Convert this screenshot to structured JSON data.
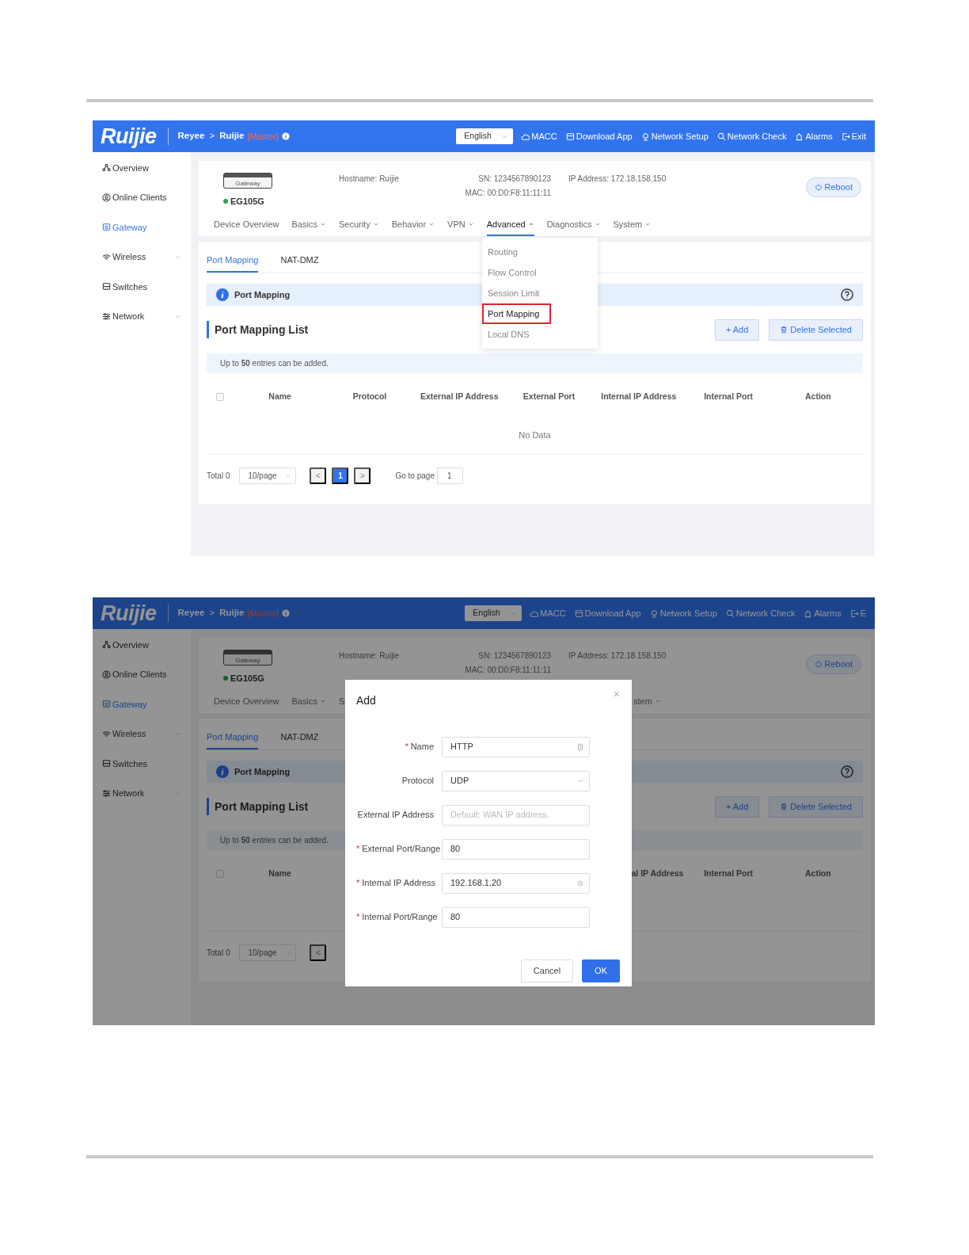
{
  "screens": [
    {
      "header": {
        "logo": "Ruijie",
        "crumbs": [
          "Reyee",
          "Ruijie"
        ],
        "separator": ">",
        "role": "[Master]",
        "language": "English",
        "links": [
          "MACC",
          "Download App",
          "Network Setup",
          "Network Check",
          "Alarms",
          "Exit"
        ]
      },
      "sidebar": [
        {
          "label": "Overview",
          "selected": false,
          "expandable": false
        },
        {
          "label": "Online Clients",
          "selected": false,
          "expandable": false
        },
        {
          "label": "Gateway",
          "selected": true,
          "expandable": false
        },
        {
          "label": "Wireless",
          "selected": false,
          "expandable": true
        },
        {
          "label": "Switches",
          "selected": false,
          "expandable": false
        },
        {
          "label": "Network",
          "selected": false,
          "expandable": true
        }
      ],
      "device": {
        "device_label": "Gateway",
        "model": "EG105G",
        "online": true,
        "hostname": "Hostname: Ruijie",
        "sn": "SN: 1234567890123",
        "mac": "MAC: 00:D0:F8:11:11:11",
        "ip": "IP Address: 172.18.158.150",
        "reboot": "Reboot"
      },
      "nav_tabs": [
        {
          "label": "Device Overview",
          "selected": false,
          "dropdown": false,
          "expanded": false
        },
        {
          "label": "Basics",
          "selected": false,
          "dropdown": true,
          "expanded": false
        },
        {
          "label": "Security",
          "selected": false,
          "dropdown": true,
          "expanded": false
        },
        {
          "label": "Behavior",
          "selected": false,
          "dropdown": true,
          "expanded": false
        },
        {
          "label": "VPN",
          "selected": false,
          "dropdown": true,
          "expanded": false
        },
        {
          "label": "Advanced",
          "selected": true,
          "dropdown": true,
          "expanded": true
        },
        {
          "label": "Diagnostics",
          "selected": false,
          "dropdown": true,
          "expanded": false
        },
        {
          "label": "System",
          "selected": false,
          "dropdown": true,
          "expanded": false
        }
      ],
      "dropdown_menu": [
        {
          "label": "Routing",
          "highlighted": false
        },
        {
          "label": "Flow Control",
          "highlighted": false
        },
        {
          "label": "Session Limit",
          "highlighted": false
        },
        {
          "label": "Port Mapping",
          "highlighted": true
        },
        {
          "label": "Local DNS",
          "highlighted": false
        }
      ],
      "sub_tabs": [
        {
          "label": "Port Mapping",
          "selected": true
        },
        {
          "label": "NAT-DMZ",
          "selected": false
        }
      ],
      "info_title": "Port Mapping",
      "list_title": "Port Mapping List",
      "buttons": [
        "+ Add",
        "Delete Selected"
      ],
      "notice": "Up to **50** entries can be added.",
      "table": {
        "checked": false,
        "columns": [
          "Name",
          "Protocol",
          "External IP Address",
          "External Port",
          "Internal IP Address",
          "Internal Port",
          "Action"
        ],
        "empty": "No Data"
      },
      "pagination": {
        "total": "Total 0",
        "page_size": "10/page",
        "prev": "<",
        "pages": [
          {
            "label": "1",
            "selected": true
          }
        ],
        "next": ">",
        "goto_label": "Go to page",
        "goto_value": "1"
      }
    },
    {
      "dimmed": true,
      "header": {
        "logo": "Ruijie",
        "crumbs": [
          "Reyee",
          "Ruijie"
        ],
        "separator": ">",
        "role": "[Master]",
        "language": "English",
        "links": [
          "MACC",
          "Download App",
          "Network Setup",
          "Network Check",
          "Alarms",
          "E"
        ]
      },
      "sidebar": [
        {
          "label": "Overview",
          "selected": false,
          "expandable": false
        },
        {
          "label": "Online Clients",
          "selected": false,
          "expandable": false
        },
        {
          "label": "Gateway",
          "selected": true,
          "expandable": false
        },
        {
          "label": "Wireless",
          "selected": false,
          "expandable": true
        },
        {
          "label": "Switches",
          "selected": false,
          "expandable": false
        },
        {
          "label": "Network",
          "selected": false,
          "expandable": true
        }
      ],
      "device": {
        "device_label": "Gateway",
        "model": "EG105G",
        "online": true,
        "hostname": "Hostname: Ruijie",
        "sn": "SN: 1234567890123",
        "mac": "MAC: 00:D0:F8:11:11:11",
        "ip": "IP Address: 172.18.158.150",
        "reboot": "Reboot"
      },
      "nav_tabs": [
        {
          "label": "Device Overview",
          "selected": false,
          "dropdown": false,
          "expanded": false
        },
        {
          "label": "Basics",
          "selected": false,
          "dropdown": true,
          "expanded": false
        },
        {
          "label": "S",
          "selected": false,
          "dropdown": false,
          "expanded": false
        }
      ],
      "nav_tabs_right": [
        {
          "label": "stem",
          "selected": false,
          "dropdown": true,
          "expanded": false
        }
      ],
      "sub_tabs": [
        {
          "label": "Port Mapping",
          "selected": true
        },
        {
          "label": "NAT-DMZ",
          "selected": false
        }
      ],
      "info_title": "Port Mapping",
      "list_title": "Port Mapping List",
      "buttons": [
        "+ Add",
        "Delete Selected"
      ],
      "notice": "Up to **50** entries can be added.",
      "table": {
        "checked": false,
        "columns": [
          "Name"
        ],
        "columns_right": [
          "al IP Address",
          "Internal Port",
          "Action"
        ]
      },
      "pagination": {
        "total": "Total 0",
        "page_size": "10/page",
        "prev": "<"
      },
      "dialog": {
        "title": "Add",
        "close": "×",
        "fields": [
          {
            "label": "Name",
            "required_mark": "*",
            "kind": "text-icon",
            "value": "HTTP"
          },
          {
            "label": "Protocol",
            "kind": "select",
            "value": "UDP"
          },
          {
            "label": "External IP Address",
            "kind": "text",
            "placeholder": "Default: WAN IP address."
          },
          {
            "label": "External Port/Range",
            "required_mark": "*",
            "kind": "text",
            "value": "80"
          },
          {
            "label": "Internal IP Address",
            "required_mark": "*",
            "kind": "clearable",
            "value": "192.168.1.20"
          },
          {
            "label": "Internal Port/Range",
            "required_mark": "*",
            "kind": "text",
            "value": "80"
          }
        ],
        "buttons": [
          {
            "label": "Cancel",
            "primary": false
          },
          {
            "label": "OK",
            "primary": true
          }
        ]
      }
    }
  ]
}
